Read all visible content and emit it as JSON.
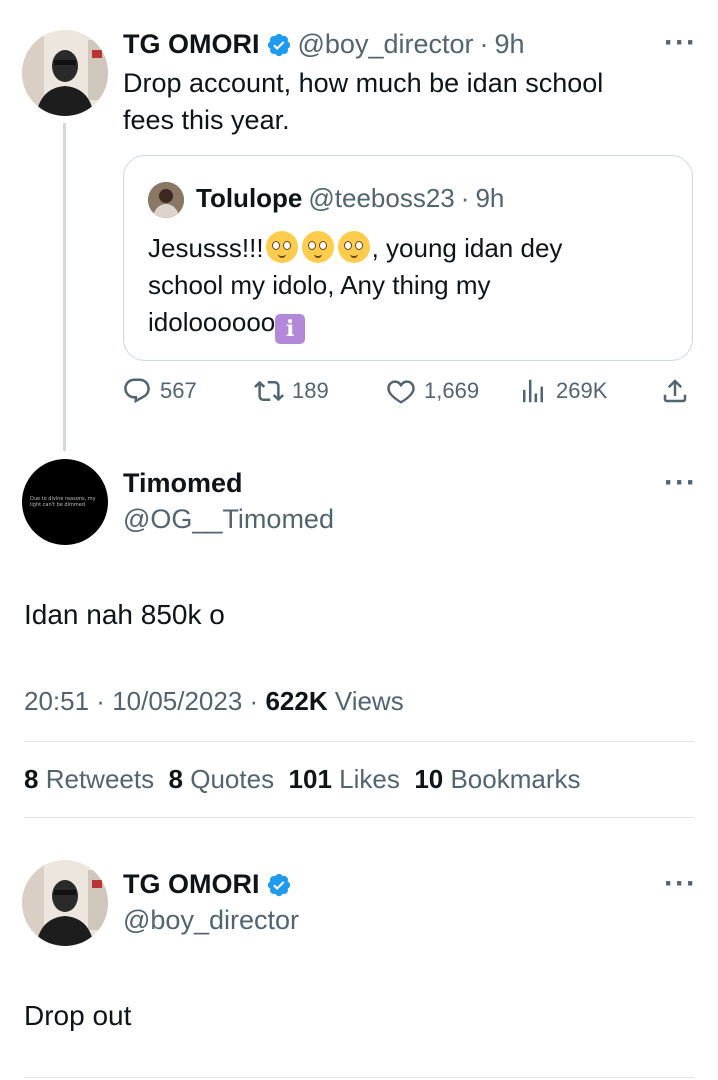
{
  "main_tweet": {
    "name": "TG OMORI",
    "handle": "@boy_director",
    "time": "9h",
    "text_line1": "Drop account, how much be idan school",
    "text_line2": "fees this year.",
    "more_icon": "more-horizontal-icon"
  },
  "quoted_tweet": {
    "name": "Tolulope",
    "handle": "@teeboss23",
    "time": "9h",
    "line1_text": "Jesusss!!!",
    "line1_rest": ", young idan dey",
    "line2": "school my  idolo, Any thing my",
    "line3_text": "idoloooooo"
  },
  "actions": {
    "replies": "567",
    "retweets": "189",
    "likes": "1,669",
    "views": "269K"
  },
  "reply_tweet": {
    "name": "Timomed",
    "handle": "@OG__Timomed",
    "avatar_text": "Due to divine reasons, my light can't be dimmed",
    "text": "Idan nah 850k o",
    "time": "20:51",
    "date": "10/05/2023",
    "views_count": "622K",
    "views_label": "Views",
    "stats": {
      "retweets_count": "8",
      "retweets_label": "Retweets",
      "quotes_count": "8",
      "quotes_label": "Quotes",
      "likes_count": "101",
      "likes_label": "Likes",
      "bookmarks_count": "10",
      "bookmarks_label": "Bookmarks"
    }
  },
  "bottom_tweet": {
    "name": "TG OMORI",
    "handle": "@boy_director",
    "text": "Drop out"
  },
  "colors": {
    "text": "#0f1419",
    "secondary": "#536471",
    "verified": "#1d9bf0",
    "border": "#cfd9de"
  }
}
